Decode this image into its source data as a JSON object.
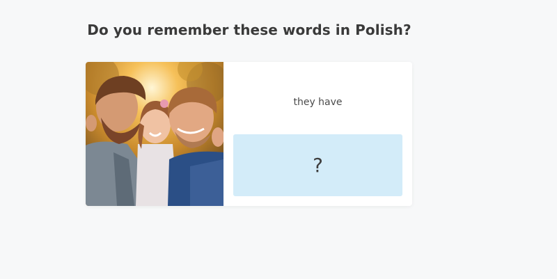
{
  "header": {
    "title": "Do you remember these words in Polish?"
  },
  "flashcard": {
    "image_description_icon": "family-photo",
    "prompt": "they have",
    "answer_placeholder": "?"
  },
  "colors": {
    "background": "#f7f8f9",
    "card": "#ffffff",
    "answer_box": "#d3ecf9",
    "title_text": "#3a3a3a"
  }
}
